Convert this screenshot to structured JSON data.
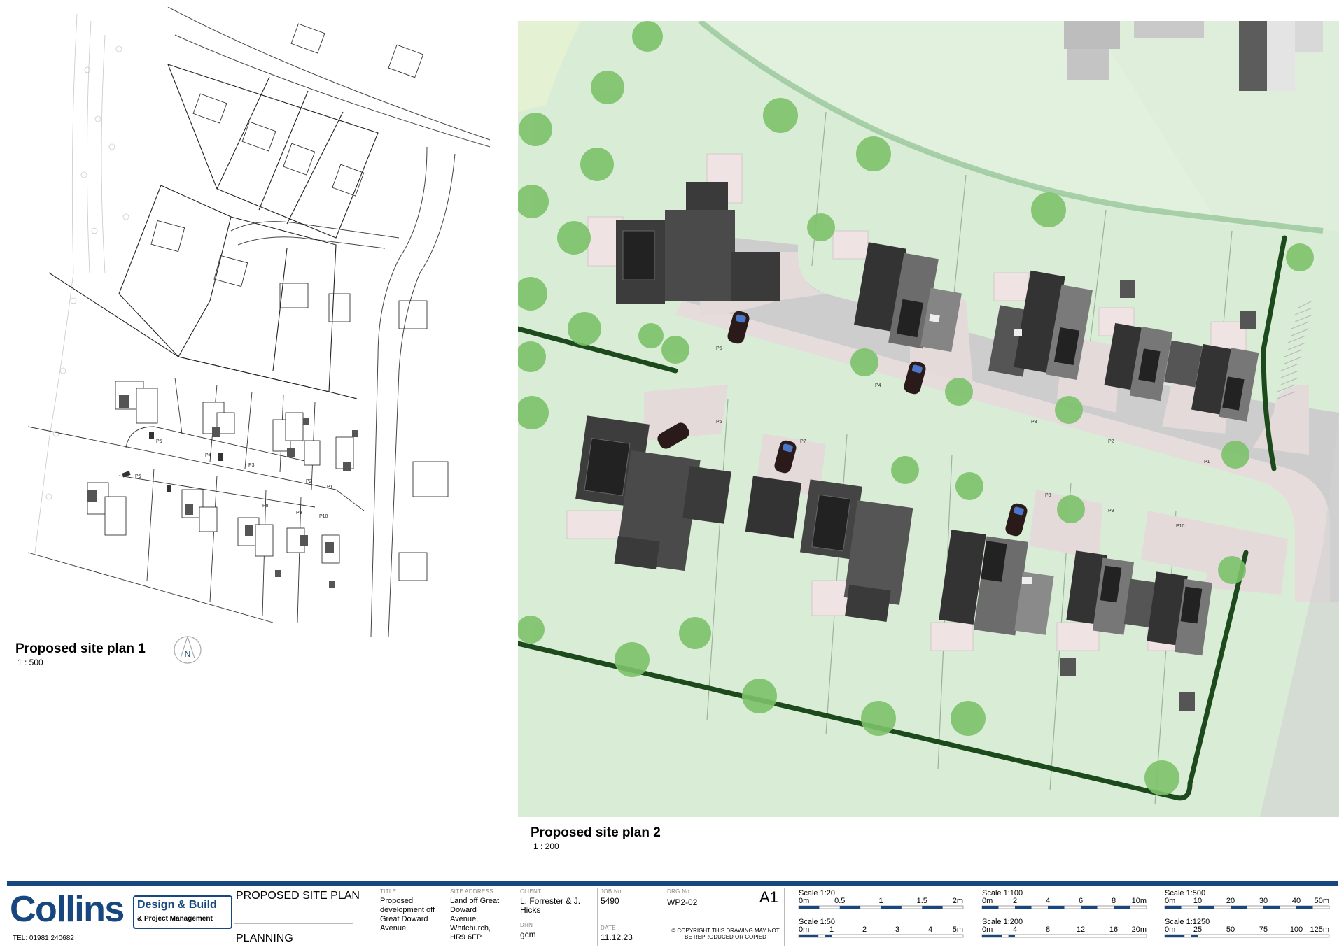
{
  "plan1": {
    "title": "Proposed site plan 1",
    "scale": "1 : 500",
    "north_label": "N",
    "plot_labels": [
      "P5",
      "P4",
      "P3",
      "P2",
      "P1",
      "P6",
      "P8",
      "P9",
      "P10"
    ]
  },
  "plan2": {
    "title": "Proposed site plan 2",
    "scale": "1 : 200",
    "plot_labels": [
      "P5",
      "P4",
      "P3",
      "P2",
      "P1",
      "P6",
      "P7",
      "P8",
      "P9",
      "P10"
    ]
  },
  "titleblock": {
    "company": "Collins",
    "tagline_1": "Design & Build",
    "tagline_2": "& Project Management",
    "tel": "TEL: 01981 240682",
    "drawing_name": "PROPOSED SITE PLAN",
    "status": "PLANNING",
    "title_label": "TITLE",
    "title_value": "Proposed development off Great Doward Avenue",
    "site_label": "SITE ADDRESS",
    "site_value": "Land off Great Doward Avenue, Whitchurch, HR9 6FP",
    "client_label": "CLIENT",
    "client_value": "L. Forrester & J. Hicks",
    "drn_label": "DRN",
    "drn_value": "gcm",
    "job_label": "JOB No.",
    "job_value": "5490",
    "date_label": "DATE",
    "date_value": "11.12.23",
    "drg_label": "DRG No.",
    "drg_value": "WP2-02",
    "sheet": "A1",
    "copyright": "© COPYRIGHT THIS DRAWING MAY NOT BE REPRODUCED OR COPIED"
  },
  "scales": [
    {
      "label": "Scale 1:20",
      "ticks": [
        "0m",
        "0.5",
        "1",
        "1.5",
        "2m"
      ]
    },
    {
      "label": "Scale 1:50",
      "ticks": [
        "0m",
        "1",
        "2",
        "3",
        "4",
        "5m"
      ]
    },
    {
      "label": "Scale 1:100",
      "ticks": [
        "0m",
        "2",
        "4",
        "6",
        "8",
        "10m"
      ]
    },
    {
      "label": "Scale 1:200",
      "ticks": [
        "0m",
        "4",
        "8",
        "12",
        "16",
        "20m"
      ]
    },
    {
      "label": "Scale 1:500",
      "ticks": [
        "0m",
        "10",
        "20",
        "30",
        "40",
        "50m"
      ]
    },
    {
      "label": "Scale 1:1250",
      "ticks": [
        "0m",
        "25",
        "50",
        "75",
        "100",
        "125m"
      ]
    }
  ],
  "colors": {
    "brand": "#17477e",
    "grass": "#d9ecd6",
    "road": "#cfcfcf",
    "hedge": "#1d4a1d",
    "tree": "#7cc26a",
    "roof": "#3a3a3a",
    "paving": "#e7dede"
  }
}
